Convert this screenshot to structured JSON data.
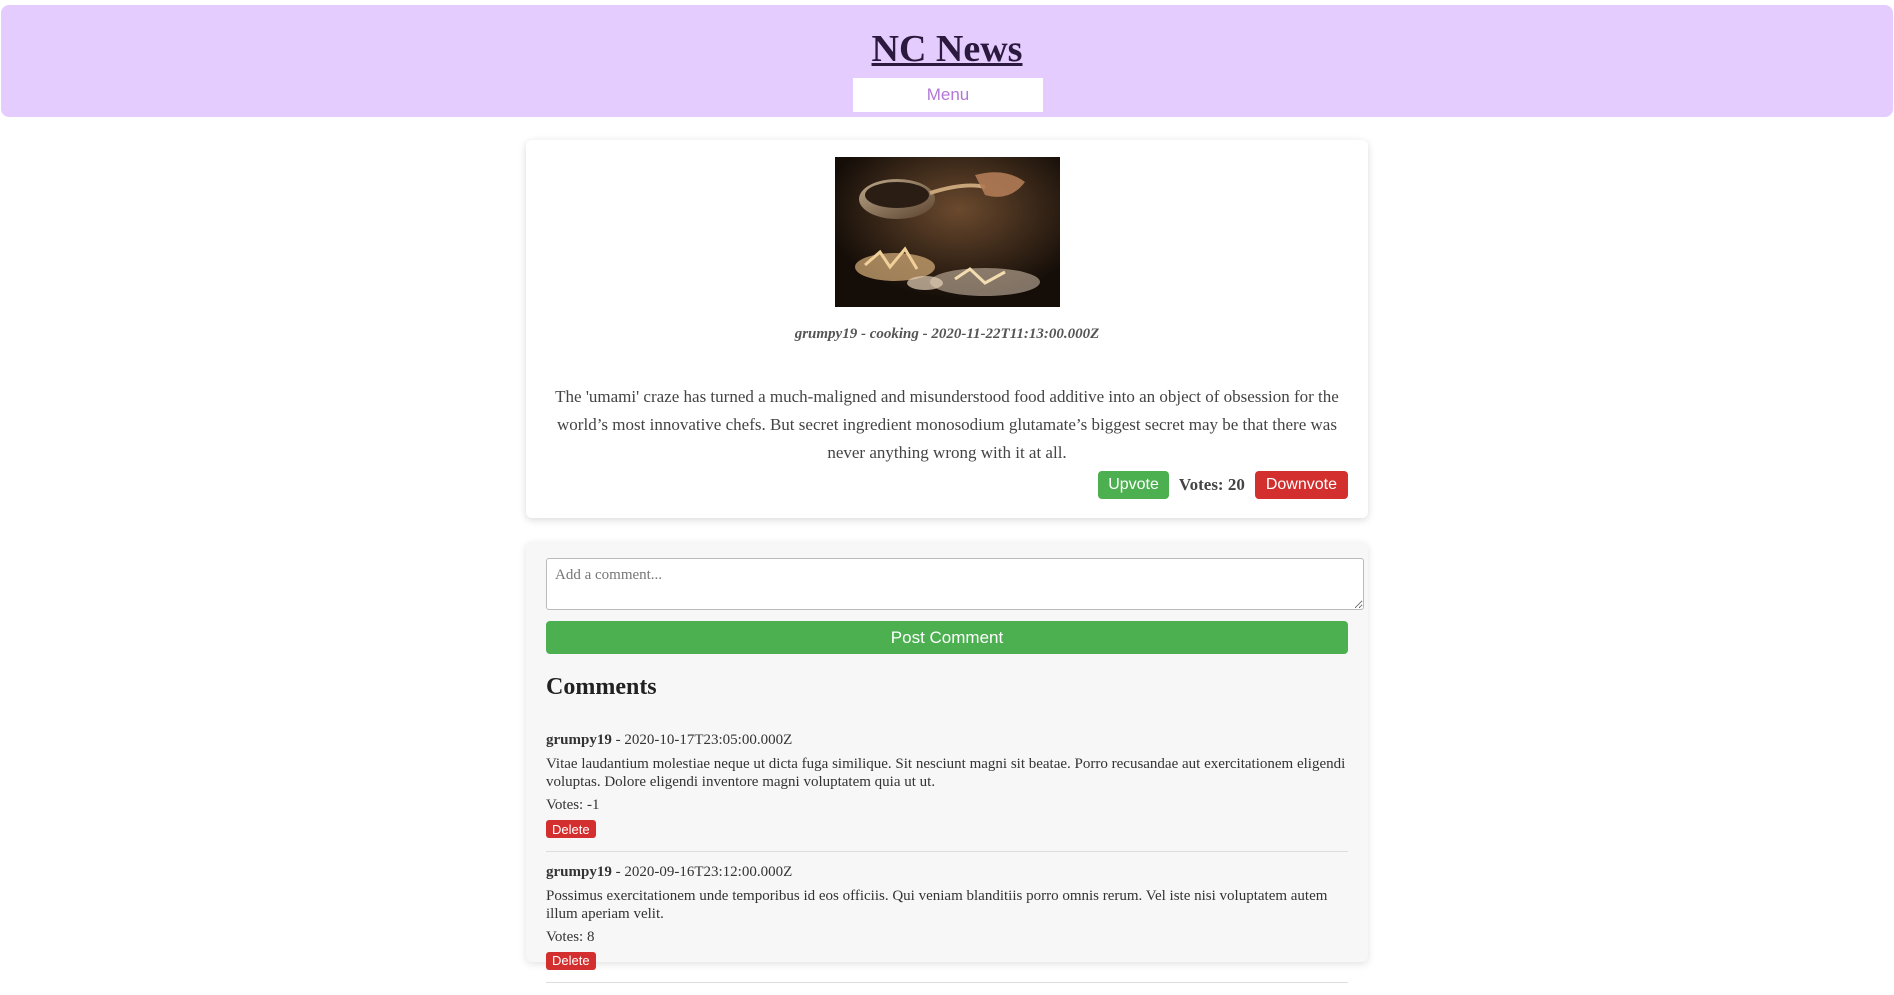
{
  "header": {
    "title": "NC News",
    "menu_label": "Menu"
  },
  "colors": {
    "header_bg": "#e4ccff",
    "upvote": "#4caf50",
    "downvote": "#d32f2f",
    "post_button": "#4caf50"
  },
  "article": {
    "image_icon": "food-photo",
    "meta": "grumpy19 - cooking - 2020-11-22T11:13:00.000Z",
    "body": "The 'umami' craze has turned a much-maligned and misunderstood food additive into an object of obsession for the world’s most innovative chefs. But secret ingredient monosodium glutamate’s biggest secret may be that there was never anything wrong with it at all.",
    "upvote_label": "Upvote",
    "votes_label": "Votes: 20",
    "downvote_label": "Downvote"
  },
  "comment_form": {
    "placeholder": "Add a comment...",
    "post_label": "Post Comment"
  },
  "comments_heading": "Comments",
  "comments": [
    {
      "author": "grumpy19",
      "date": " - 2020-10-17T23:05:00.000Z",
      "body": "Vitae laudantium molestiae neque ut dicta fuga similique. Sit nesciunt magni sit beatae. Porro recusandae aut exercitationem eligendi voluptas. Dolore eligendi inventore magni voluptatem quia ut ut.",
      "votes": "Votes: -1",
      "delete_label": "Delete"
    },
    {
      "author": "grumpy19",
      "date": " - 2020-09-16T23:12:00.000Z",
      "body": "Possimus exercitationem unde temporibus id eos officiis. Qui veniam blanditiis porro omnis rerum. Vel iste nisi voluptatem autem illum aperiam velit.",
      "votes": "Votes: 8",
      "delete_label": "Delete"
    }
  ]
}
